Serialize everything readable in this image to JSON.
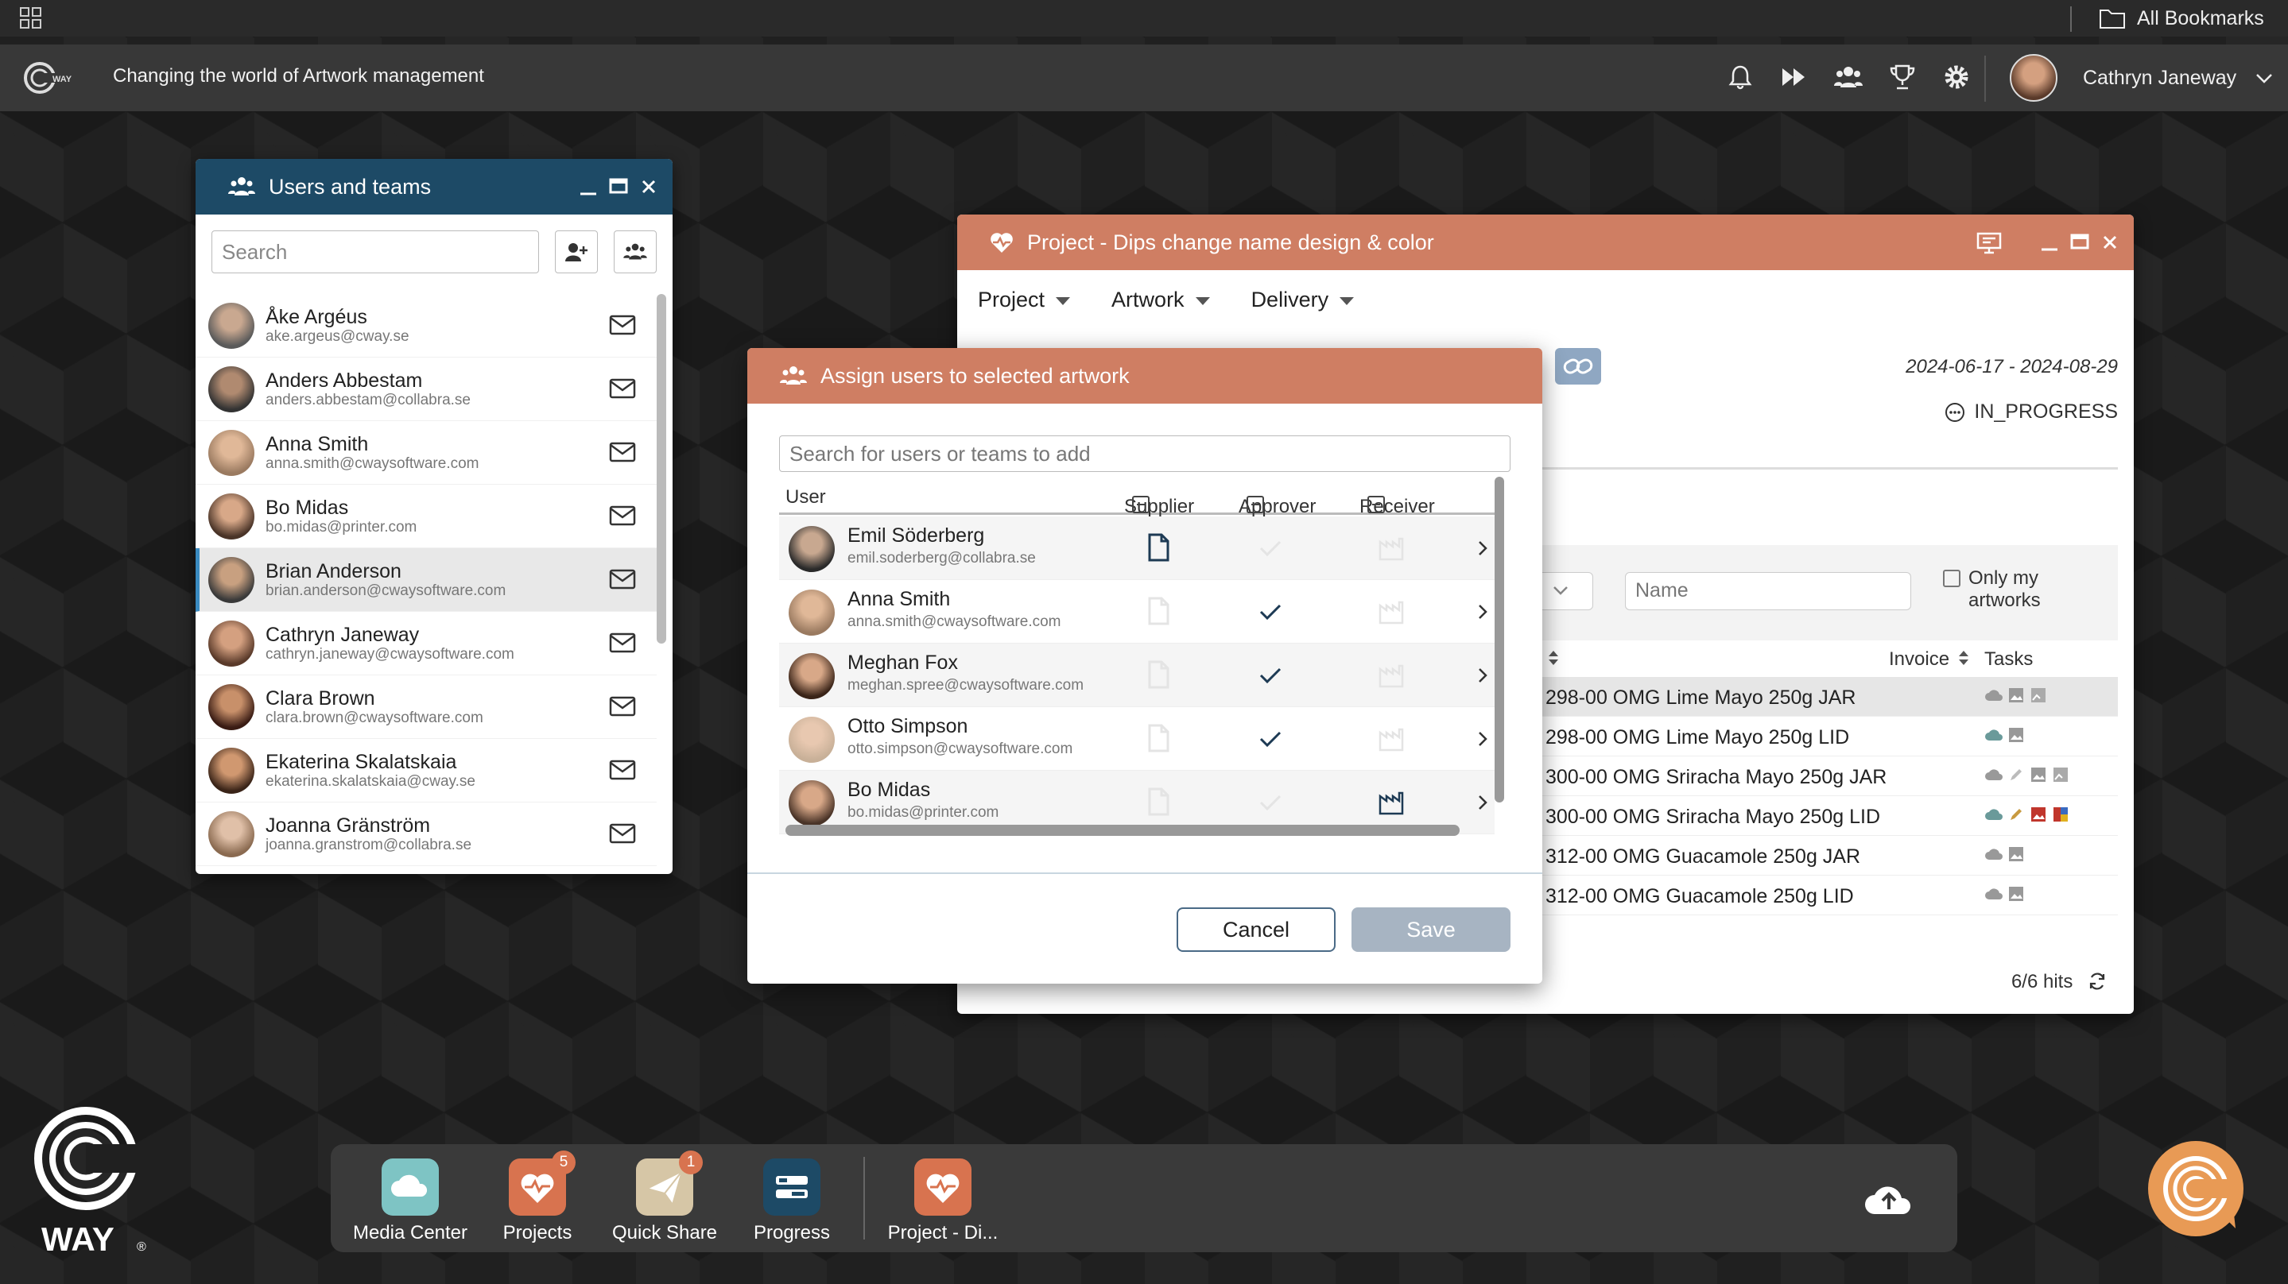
{
  "sysbar": {
    "bookmarks_label": "All Bookmarks"
  },
  "appbar": {
    "title": "Changing the world of Artwork management",
    "user_name": "Cathryn Janeway"
  },
  "users_window": {
    "title": "Users and teams",
    "search_placeholder": "Search",
    "users": [
      {
        "name": "Åke Argéus",
        "email": "ake.argeus@cway.se"
      },
      {
        "name": "Anders Abbestam",
        "email": "anders.abbestam@collabra.se"
      },
      {
        "name": "Anna Smith",
        "email": "anna.smith@cwaysoftware.com"
      },
      {
        "name": "Bo Midas",
        "email": "bo.midas@printer.com"
      },
      {
        "name": "Brian Anderson",
        "email": "brian.anderson@cwaysoftware.com"
      },
      {
        "name": "Cathryn Janeway",
        "email": "cathryn.janeway@cwaysoftware.com"
      },
      {
        "name": "Clara Brown",
        "email": "clara.brown@cwaysoftware.com"
      },
      {
        "name": "Ekaterina Skalatskaia",
        "email": "ekaterina.skalatskaia@cway.se"
      },
      {
        "name": "Joanna Gränström",
        "email": "joanna.granstrom@collabra.se"
      }
    ]
  },
  "project_window": {
    "title": "Project - Dips change name design & color",
    "menu": [
      "Project",
      "Artwork",
      "Delivery"
    ],
    "dates": "2024-06-17 - 2024-08-29",
    "status": "IN_PROGRESS",
    "name_placeholder": "Name",
    "only_my_artworks": "Only my artworks",
    "col_invoice": "Invoice",
    "col_tasks": "Tasks",
    "artworks": [
      "298-00 OMG Lime Mayo 250g JAR",
      "298-00 OMG Lime Mayo 250g LID",
      "300-00 OMG Sriracha Mayo 250g JAR",
      "300-00 OMG Sriracha Mayo 250g LID",
      "312-00 OMG Guacamole 250g JAR",
      "312-00 OMG Guacamole 250g LID"
    ],
    "hits": "6/6 hits"
  },
  "assign_dialog": {
    "title": "Assign users to selected artwork",
    "search_placeholder": "Search for users or teams to add",
    "col_user": "User",
    "col_supplier": "Supplier",
    "col_approver": "Approver",
    "col_receiver": "Receiver",
    "rows": [
      {
        "name": "Emil Söderberg",
        "email": "emil.soderberg@collabra.se",
        "supplier": true,
        "approver": false,
        "receiver": false
      },
      {
        "name": "Anna Smith",
        "email": "anna.smith@cwaysoftware.com",
        "supplier": false,
        "approver": true,
        "receiver": false
      },
      {
        "name": "Meghan Fox",
        "email": "meghan.spree@cwaysoftware.com",
        "supplier": false,
        "approver": true,
        "receiver": false
      },
      {
        "name": "Otto Simpson",
        "email": "otto.simpson@cwaysoftware.com",
        "supplier": false,
        "approver": true,
        "receiver": false
      },
      {
        "name": "Bo Midas",
        "email": "bo.midas@printer.com",
        "supplier": false,
        "approver": false,
        "receiver": true
      }
    ],
    "cancel_label": "Cancel",
    "save_label": "Save"
  },
  "dock": {
    "items": [
      {
        "label": "Media Center",
        "badge": ""
      },
      {
        "label": "Projects",
        "badge": "5"
      },
      {
        "label": "Quick Share",
        "badge": "1"
      },
      {
        "label": "Progress",
        "badge": ""
      },
      {
        "label": "Project - Di...",
        "badge": ""
      }
    ]
  },
  "brand": {
    "logo_text": "WAY"
  },
  "colors": {
    "accent": "#cf7e63",
    "navy": "#1d4a66",
    "dock": "#3a3a3a"
  }
}
